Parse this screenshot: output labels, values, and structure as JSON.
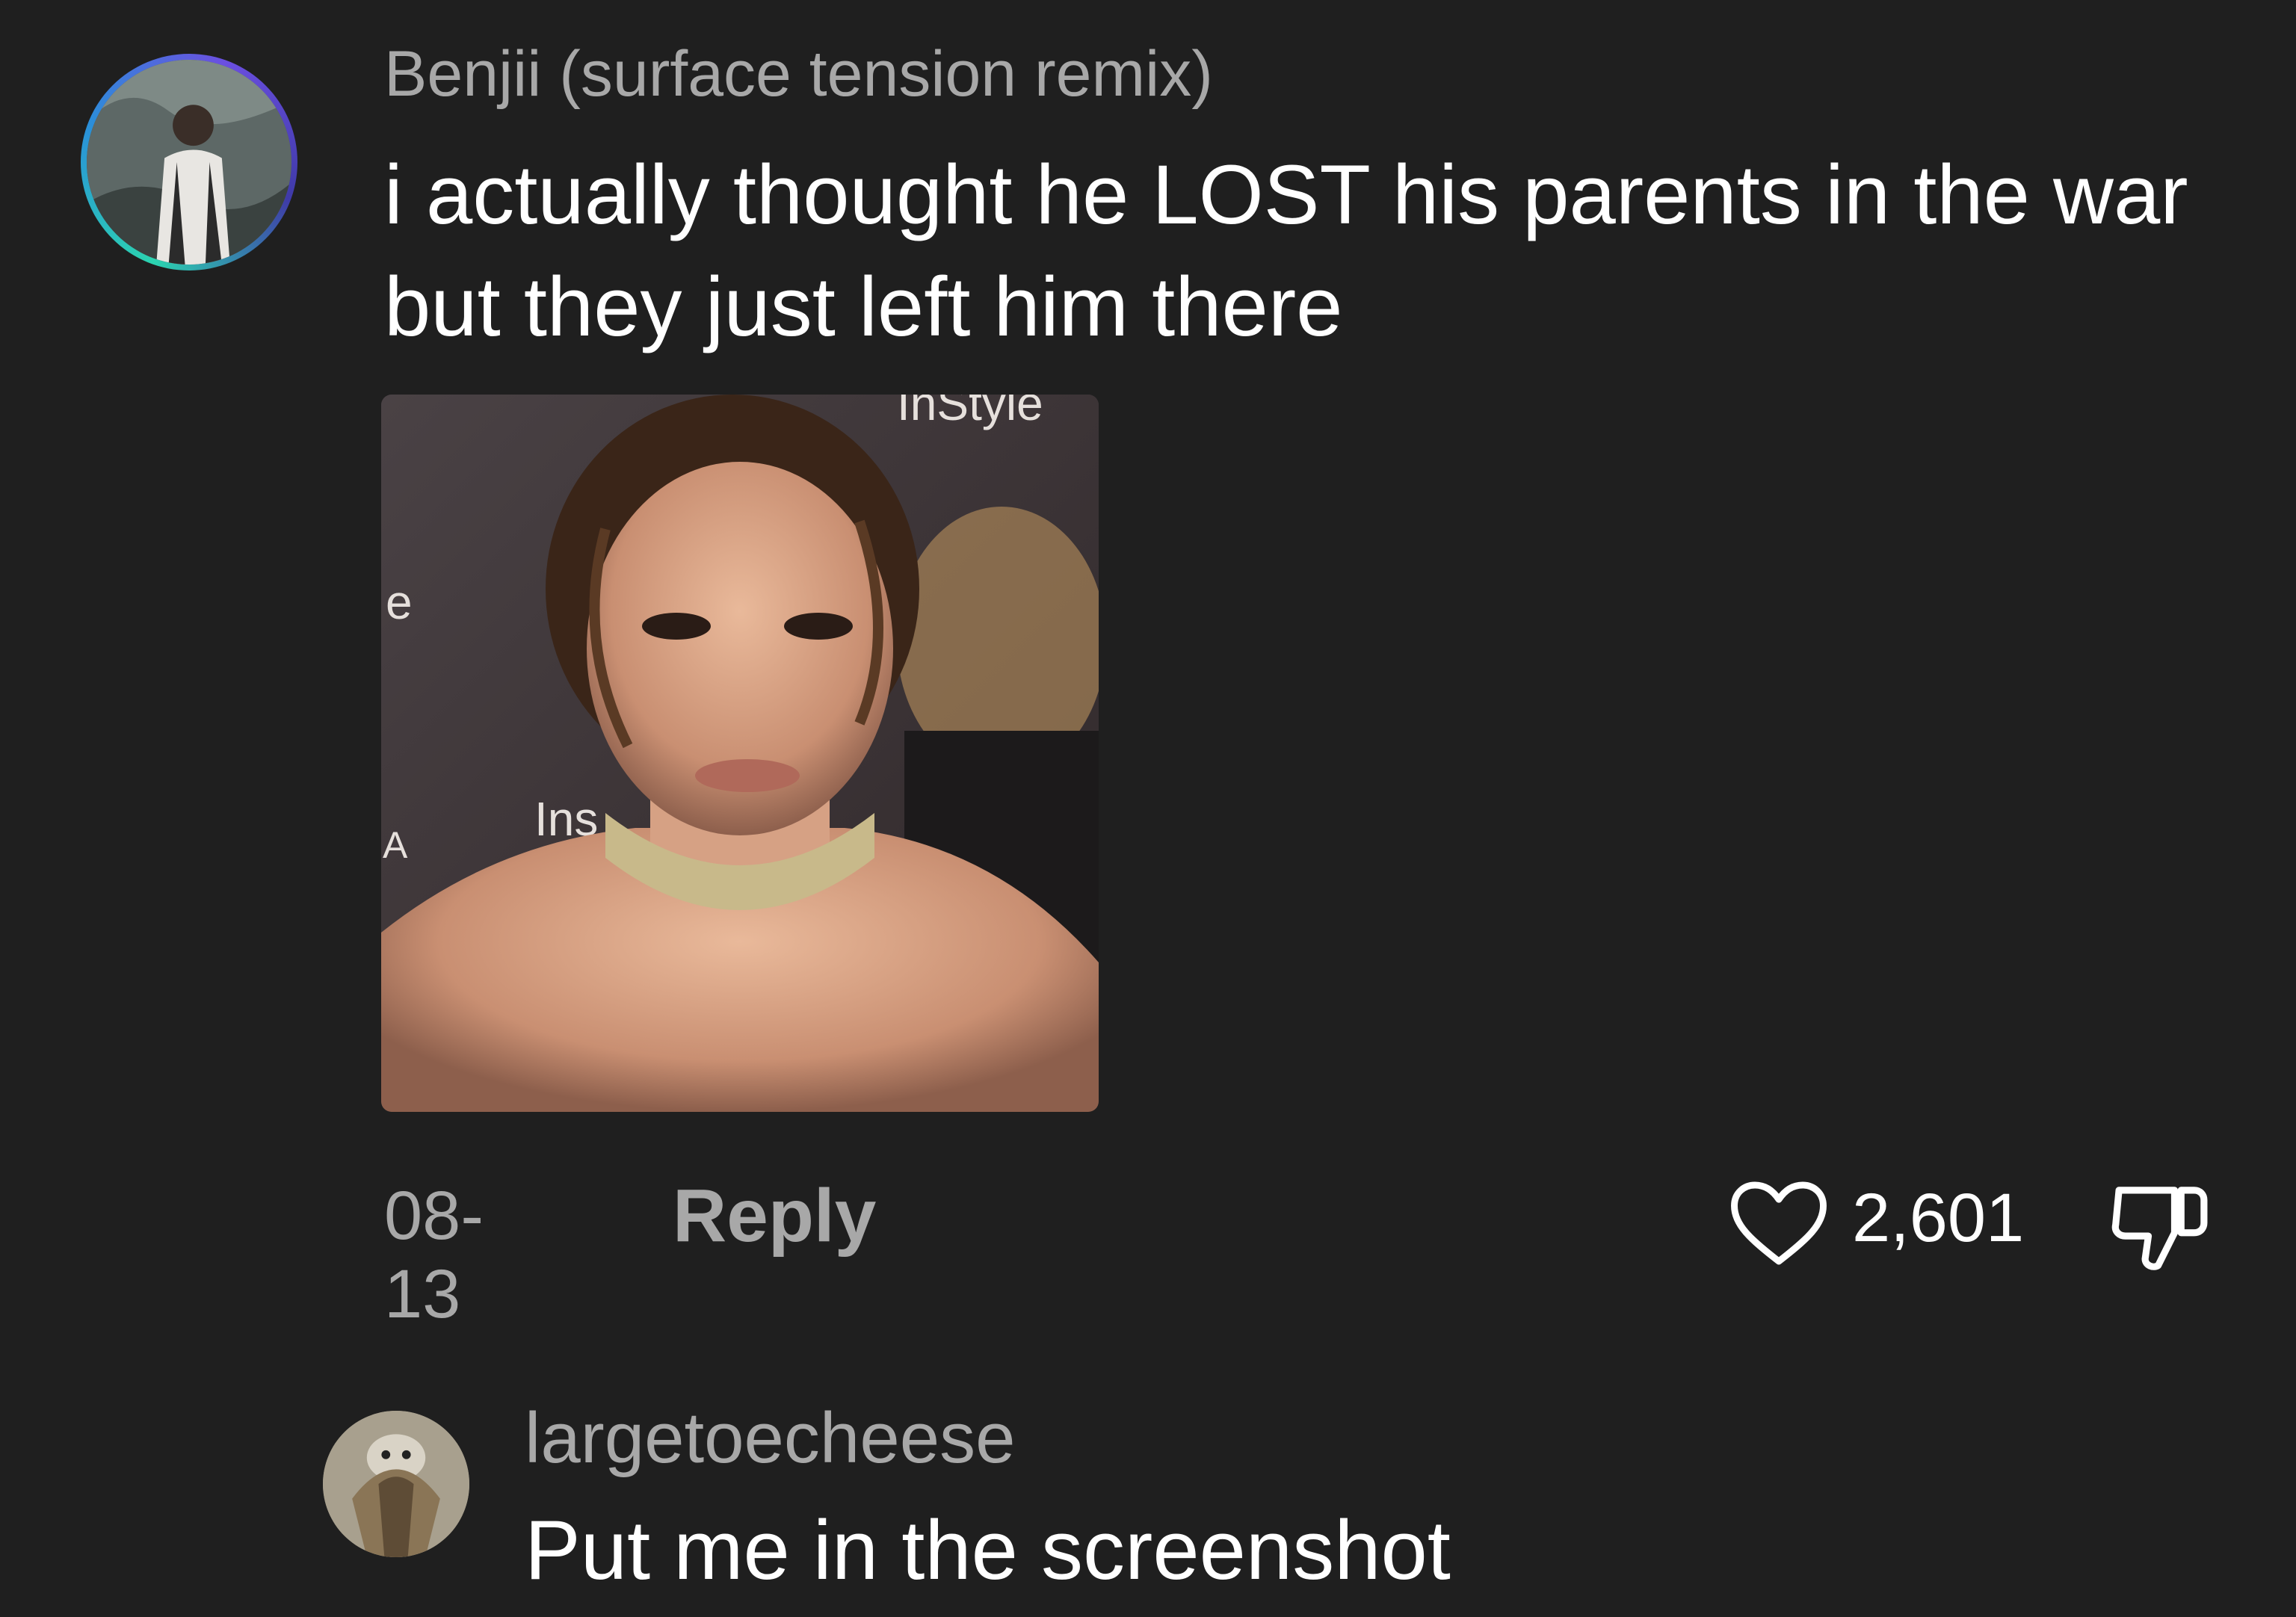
{
  "comments": [
    {
      "username": "Benjii (surface tension remix)",
      "text": "i actually thought he LOST his parents in the war but they just left him there",
      "date": "08-13",
      "reply_label": "Reply",
      "like_count": "2,601",
      "has_image": true,
      "image_overlay_text": [
        "InStyle",
        "e",
        "A",
        "Ins"
      ]
    },
    {
      "username": "largetoecheese",
      "text": "Put me in the screenshot"
    }
  ],
  "icons": {
    "like": "heart-outline-icon",
    "dislike": "thumbs-down-icon"
  },
  "colors": {
    "background": "#1f1f1f",
    "primary_text": "#ffffff",
    "secondary_text": "#a8a8a8"
  }
}
